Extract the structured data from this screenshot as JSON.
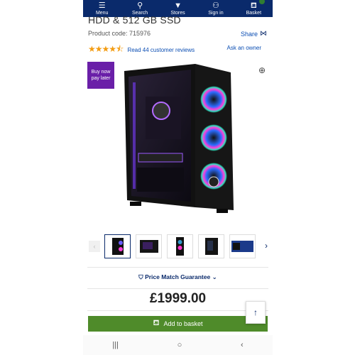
{
  "nav": {
    "items": [
      {
        "label": "Menu",
        "icon": "menu-icon",
        "glyph": "☰"
      },
      {
        "label": "Search",
        "icon": "search-icon",
        "glyph": "⚲"
      },
      {
        "label": "Stores",
        "icon": "location-pin-icon",
        "glyph": "▼"
      },
      {
        "label": "Sign in",
        "icon": "user-icon",
        "glyph": "⚇"
      },
      {
        "label": "Basket",
        "icon": "basket-icon",
        "glyph": "⛾"
      }
    ],
    "background": "#0a2a6b"
  },
  "product": {
    "title": "HDD & 512 GB SSD",
    "code_label": "Product code: 715976",
    "share_label": "Share",
    "rating": 4.5,
    "reviews_label": "Read 44 customer reviews",
    "ask_owner_label": "Ask an owner",
    "bnpl_label_line1": "Buy now",
    "bnpl_label_line2": "pay later",
    "thumbnail_count": 5,
    "selected_thumbnail": 1
  },
  "price_match_label": "Price Match Guarantee",
  "price": "£1999.00",
  "add_to_basket_label": "Add to basket",
  "colors": {
    "accent": "#0a2a6b",
    "link": "#0a4db3",
    "star": "#f39c12",
    "bnpl": "#6a1fa8",
    "basket_button": "#4f8b2a"
  },
  "system_nav": {
    "recents_glyph": "|||",
    "home_glyph": "○",
    "back_glyph": "‹"
  }
}
